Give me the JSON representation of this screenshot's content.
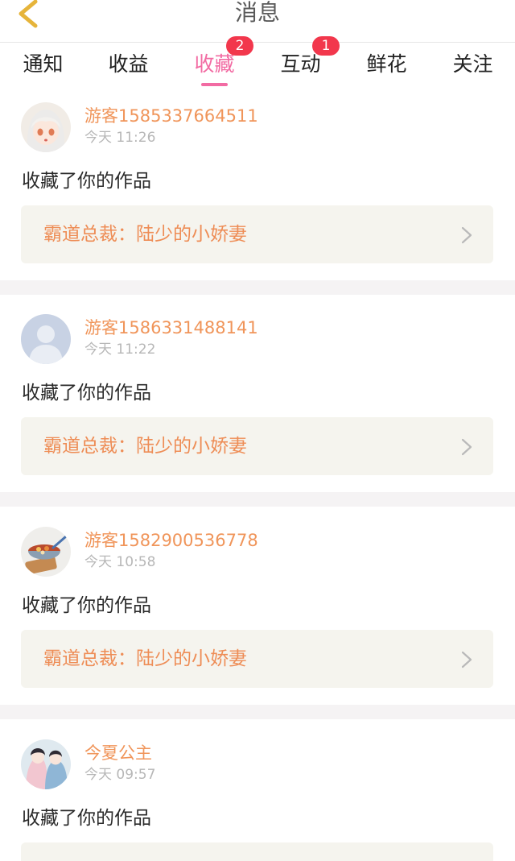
{
  "header": {
    "title": "消息",
    "back_icon": "chevron-left-icon"
  },
  "tabs": [
    {
      "label": "通知",
      "badge": ""
    },
    {
      "label": "收益",
      "badge": ""
    },
    {
      "label": "收藏",
      "badge": "2",
      "active": true
    },
    {
      "label": "互动",
      "badge": "1"
    },
    {
      "label": "鲜花",
      "badge": ""
    },
    {
      "label": "关注",
      "badge": ""
    }
  ],
  "messages": [
    {
      "user": "游客1585337664511",
      "time": "今天 11:26",
      "text": "收藏了你的作品",
      "work": "霸道总裁：陆少的小娇妻"
    },
    {
      "user": "游客1586331488141",
      "time": "今天 11:22",
      "text": "收藏了你的作品",
      "work": "霸道总裁：陆少的小娇妻"
    },
    {
      "user": "游客1582900536778",
      "time": "今天 10:58",
      "text": "收藏了你的作品",
      "work": "霸道总裁：陆少的小娇妻"
    },
    {
      "user": "今夏公主",
      "time": "今天 09:57",
      "text": "收藏了你的作品",
      "work": ""
    }
  ],
  "colors": {
    "accent": "#f26ba3",
    "badge": "#f2374c",
    "username": "#f0955a",
    "work_title": "#ee8d56",
    "card_bg": "#f5f4ee",
    "back_icon": "#e6b43a"
  }
}
